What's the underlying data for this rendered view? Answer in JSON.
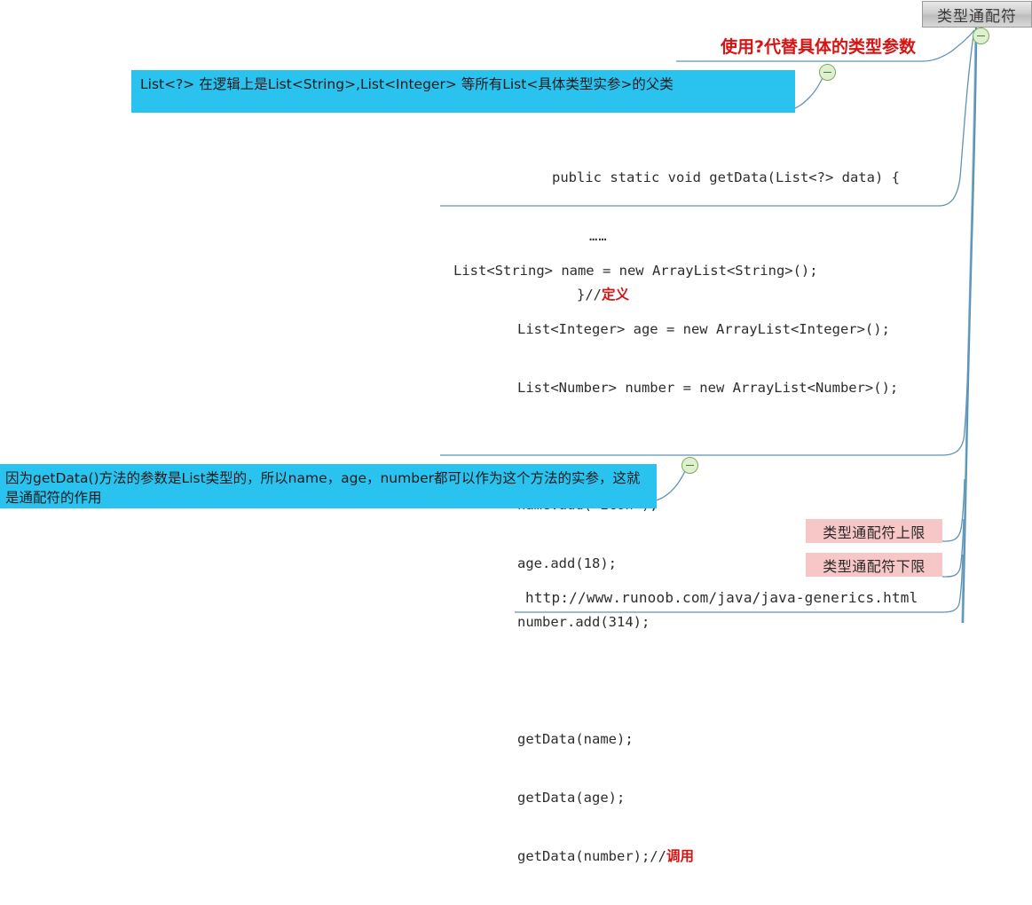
{
  "root": {
    "label": "类型通配符"
  },
  "heading": {
    "text": "使用?代替具体的类型参数"
  },
  "notes": {
    "wildcard_superclass": "List<?> 在逻辑上是List<String>,List<Integer> 等所有List<具体类型实参>的父类",
    "why_works": "因为getData()方法的参数是List类型的，所以name，age，number都可以作为这个方法的实参，这就是通配符的作用"
  },
  "code_definition": {
    "line1": "public static void getData(List<?> data) {",
    "line2": "……",
    "line3": "}//",
    "comment": "定义"
  },
  "code_usage": {
    "lines": [
      "List<String> name = new ArrayList<String>();",
      "List<Integer> age = new ArrayList<Integer>();",
      "List<Number> number = new ArrayList<Number>();",
      "",
      "name.add(\"icon\");",
      "age.add(18);",
      "number.add(314);",
      "",
      "getData(name);",
      "getData(age);",
      "getData(number);//"
    ],
    "comment": "调用"
  },
  "branches": {
    "upper_bound": "类型通配符上限",
    "lower_bound": "类型通配符下限"
  },
  "reference": {
    "url": "http://www.runoob.com/java/java-generics.html"
  },
  "icons": {
    "collapse": "minus-circle"
  },
  "colors": {
    "cyan_note": "#2ac3f0",
    "pink_node": "#f7c6c6",
    "red_accent": "#d71414",
    "branch_line": "#4a7fa5",
    "toggle_green": "#7aab59"
  }
}
